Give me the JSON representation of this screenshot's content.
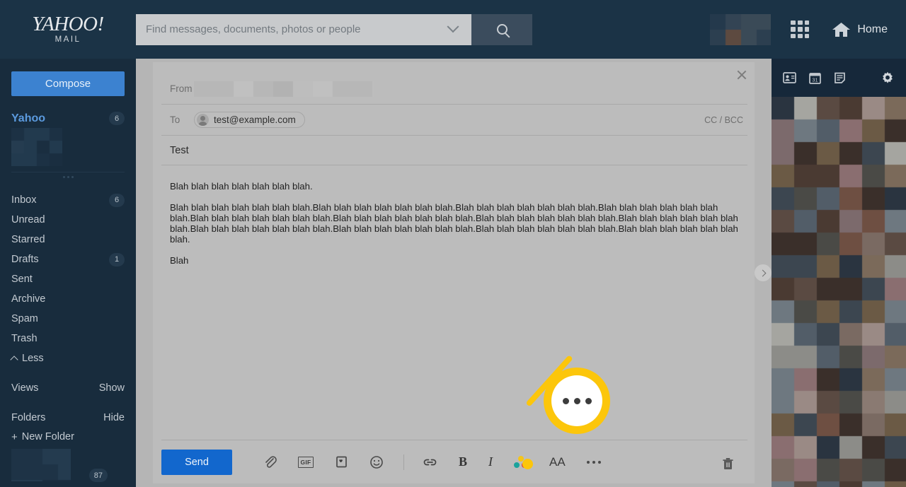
{
  "header": {
    "logo_main": "YAHOO!",
    "logo_sub": "MAIL",
    "search_placeholder": "Find messages, documents, photos or people",
    "search_value": "",
    "search_icon": "search-icon",
    "dropdown_icon": "chevron-down-icon",
    "apps_icon": "apps-grid-icon",
    "home_label": "Home",
    "home_icon": "home-icon",
    "avatar_blurred": true
  },
  "sidebar": {
    "compose_label": "Compose",
    "account": {
      "name": "Yahoo",
      "badge": "6"
    },
    "items": [
      {
        "label": "Inbox",
        "badge": "6"
      },
      {
        "label": "Unread",
        "badge": ""
      },
      {
        "label": "Starred",
        "badge": ""
      },
      {
        "label": "Drafts",
        "badge": "1"
      },
      {
        "label": "Sent",
        "badge": ""
      },
      {
        "label": "Archive",
        "badge": ""
      },
      {
        "label": "Spam",
        "badge": ""
      },
      {
        "label": "Trash",
        "badge": ""
      }
    ],
    "less_label": "Less",
    "sections": [
      {
        "label": "Views",
        "action": "Show"
      },
      {
        "label": "Folders",
        "action": "Hide"
      }
    ],
    "new_folder_label": "New Folder",
    "folder_badge": "87"
  },
  "compose": {
    "close_icon": "close-icon",
    "from_label": "From",
    "from_value_blurred": true,
    "to_label": "To",
    "recipient": "test@example.com",
    "recipient_avatar_icon": "person-avatar-icon",
    "ccbcc_label": "CC / BCC",
    "subject": "Test",
    "body_paragraphs": [
      "Blah blah blah blah blah blah blah.",
      "Blah blah blah blah blah blah blah.Blah blah blah blah blah blah blah.Blah blah blah blah blah blah blah.Blah blah blah blah blah blah blah.Blah blah blah blah blah blah blah.Blah blah blah blah blah blah blah.Blah blah blah blah blah blah blah.Blah blah blah blah blah blah blah.Blah blah blah blah blah blah blah.Blah blah blah blah blah blah blah.Blah blah blah blah blah blah blah.Blah blah blah blah blah blah blah.",
      "Blah"
    ],
    "expander_icon": "chevron-right-icon"
  },
  "toolbar": {
    "send_label": "Send",
    "attach_icon": "paperclip-icon",
    "gif_label": "GIF",
    "gif_icon": "gif-icon",
    "image_icon": "photo-card-icon",
    "emoji_icon": "emoji-smiley-icon",
    "link_icon": "link-icon",
    "bold_label": "B",
    "bold_icon": "bold-icon",
    "italic_label": "I",
    "italic_icon": "italic-icon",
    "color_icon": "color-palette-icon",
    "font_label": "AA",
    "font_icon": "font-size-icon",
    "more_icon": "more-options-icon",
    "trash_icon": "trash-icon"
  },
  "rail": {
    "contacts_icon": "contacts-card-icon",
    "calendar_icon": "calendar-icon",
    "calendar_day": "31",
    "notepad_icon": "notepad-icon",
    "settings_icon": "gear-icon",
    "ad_blurred": true
  },
  "annotation": {
    "type": "callout-magnifier",
    "target_icon": "more-options-icon",
    "color": "#fcc60b"
  },
  "colors": {
    "header_bg": "#1b3346",
    "sidebar_bg": "#182c3d",
    "compose_bg": "#bcbcbc",
    "send_blue": "#1267cd",
    "compose_blue": "#3c82d0",
    "account_blue": "#5b9ade",
    "annotation_yellow": "#fcc60b"
  }
}
